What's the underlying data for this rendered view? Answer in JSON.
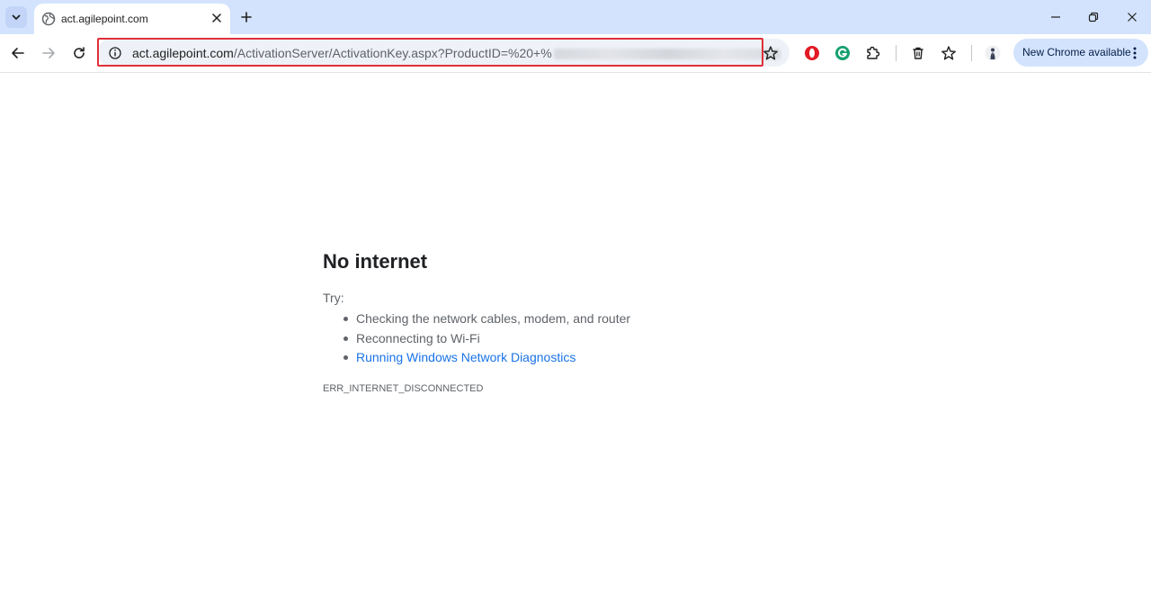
{
  "browser": {
    "tab": {
      "title": "act.agilepoint.com"
    },
    "url": {
      "host": "act.agilepoint.com",
      "path": "/ActivationServer/ActivationKey.aspx?ProductID=%20+%"
    },
    "update_button": {
      "label": "New Chrome available"
    },
    "icons": {
      "tab_search": "chevron-down-icon",
      "favicon": "globe-icon",
      "tab_close": "close-icon",
      "new_tab": "plus-icon",
      "minimize": "minimize-icon",
      "restore": "restore-icon",
      "window_close": "close-icon",
      "back": "arrow-left-icon",
      "forward": "arrow-right-icon",
      "reload": "reload-icon",
      "site_info": "info-icon",
      "bookmark": "star-icon",
      "opera_extension": "opera-icon",
      "grammarly_extension": "grammarly-icon",
      "extensions": "puzzle-icon",
      "delete": "trash-icon",
      "bookmarks": "star-icon",
      "profile": "avatar-icon",
      "menu": "kebab-menu-icon"
    },
    "colors": {
      "tabstrip": "#d3e3fd",
      "highlight_border": "#e0303a",
      "link": "#1a73e8"
    }
  },
  "page": {
    "heading": "No internet",
    "try_label": "Try:",
    "suggestions": [
      "Checking the network cables, modem, and router",
      "Reconnecting to Wi-Fi",
      "Running Windows Network Diagnostics"
    ],
    "error_code": "ERR_INTERNET_DISCONNECTED"
  }
}
